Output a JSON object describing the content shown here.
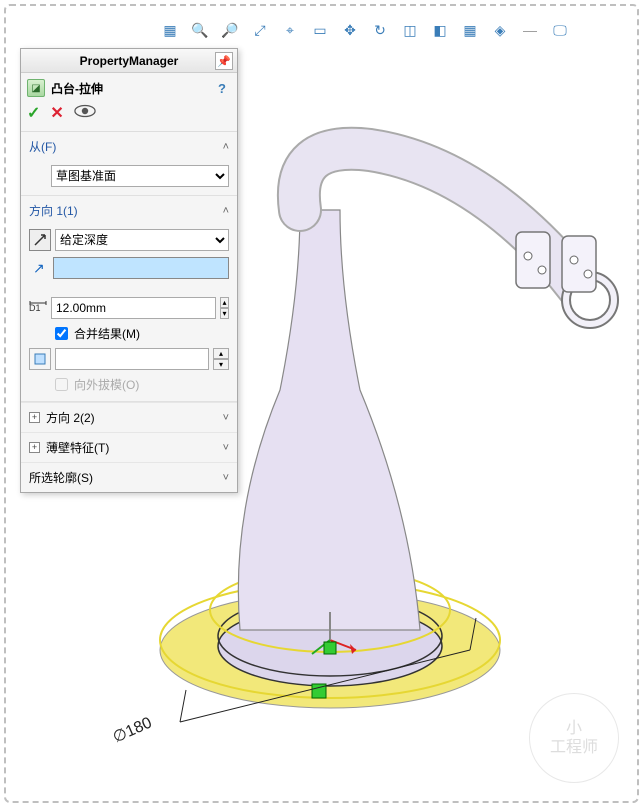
{
  "toolbar": {
    "icons": [
      "cube-green",
      "zoom-in",
      "zoom-window",
      "zoom-fit",
      "zoom-area",
      "doc",
      "pan",
      "rotate",
      "section",
      "cube-blue",
      "multi-cube",
      "color",
      "monitor"
    ]
  },
  "pm": {
    "title": "PropertyManager",
    "feature_name": "凸台-拉伸",
    "help": "?",
    "sections": {
      "from": {
        "label": "从(F)",
        "value": "草图基准面"
      },
      "dir1": {
        "label": "方向 1(1)",
        "end_condition": "给定深度",
        "depth_value": "",
        "depth_d1": "12.00mm",
        "merge_result": "合并结果(M)",
        "draft_outward": "向外拔模(O)"
      },
      "dir2": {
        "label": "方向 2(2)"
      },
      "thin": {
        "label": "薄壁特征(T)"
      },
      "contours": {
        "label": "所选轮廓(S)"
      }
    }
  },
  "viewport": {
    "dimension": "∅180",
    "watermark_top": "小",
    "watermark_bottom": "工程师"
  }
}
